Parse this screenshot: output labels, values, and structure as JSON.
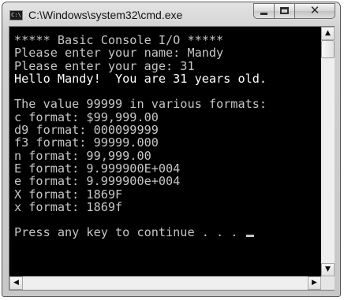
{
  "window": {
    "title": "C:\\Windows\\system32\\cmd.exe",
    "icon_label": "C:\\",
    "controls": {
      "minimize_icon": "minimize-icon",
      "maximize_icon": "maximize-icon",
      "close_icon": "close-icon",
      "close_glyph": "✕"
    }
  },
  "console": {
    "background": "#000000",
    "foreground": "#c6c6c6",
    "lines": [
      "***** Basic Console I/O *****",
      "Please enter your name: Mandy",
      "Please enter your age: 31",
      "Hello Mandy!  You are 31 years old.",
      "",
      "The value 99999 in various formats:",
      "c format: $99,999.00",
      "d9 format: 000099999",
      "f3 format: 99999.000",
      "n format: 99,999.00",
      "E format: 9.999900E+004",
      "e format: 9.999900e+004",
      "X format: 1869F",
      "x format: 1869f",
      "",
      "Press any key to continue . . . "
    ]
  },
  "scrollbars": {
    "vertical": {
      "up_arrow": "▲",
      "down_arrow": "▼"
    },
    "horizontal": {
      "left_arrow": "◀",
      "right_arrow": "▶"
    }
  }
}
